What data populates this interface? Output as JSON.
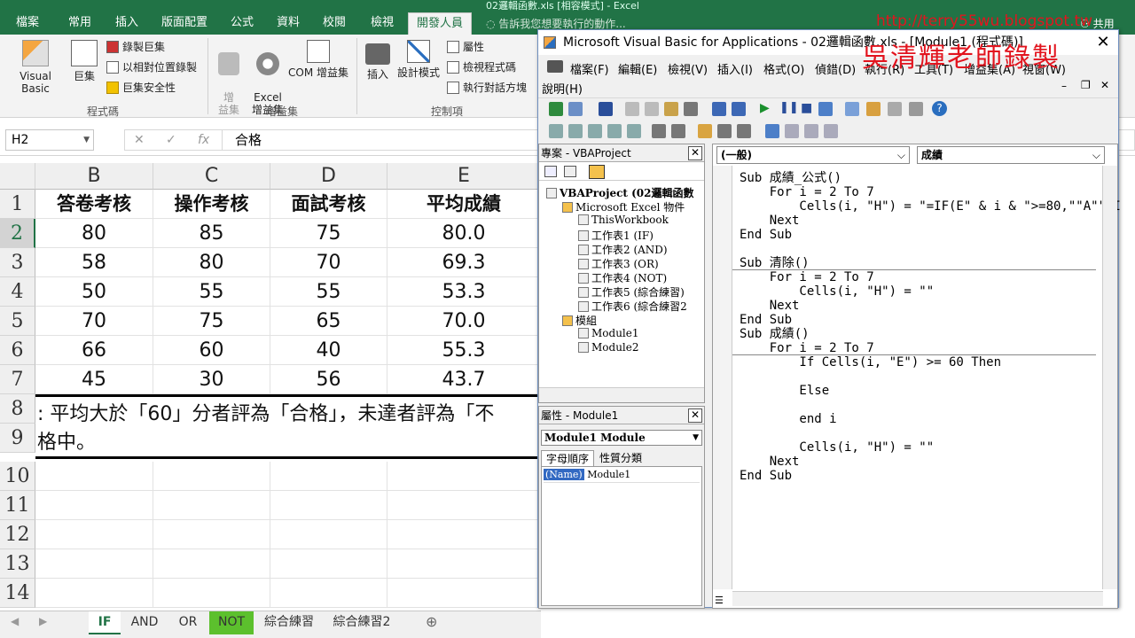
{
  "excel": {
    "title": "02邏輯函數.xls [相容模式] - Excel",
    "tellme": "告訴我您想要執行的動作...",
    "share": "共用",
    "tabs": [
      "檔案",
      "常用",
      "插入",
      "版面配置",
      "公式",
      "資料",
      "校閱",
      "檢視",
      "開發人員"
    ],
    "active_tab": "開發人員",
    "ribbon": {
      "code_group": "程式碼",
      "addins_group": "增益集",
      "controls_group": "控制項",
      "visual_basic": "Visual Basic",
      "macros": "巨集",
      "record_macro": "錄製巨集",
      "relative_ref": "以相對位置錄製",
      "macro_security": "巨集安全性",
      "addins": "增\n益集",
      "excel_addins": "Excel\n增益集",
      "com_addins": "COM 增益集",
      "insert": "插入",
      "design_mode": "設計模式",
      "properties": "屬性",
      "view_code": "檢視程式碼",
      "run_dialog": "執行對話方塊"
    },
    "namebox": "H2",
    "formula": "合格",
    "columns": [
      "B",
      "C",
      "D",
      "E"
    ],
    "rows": [
      "1",
      "2",
      "3",
      "4",
      "5",
      "6",
      "7",
      "8",
      "9",
      "10",
      "11",
      "12",
      "13",
      "14"
    ],
    "headers": [
      "答卷考核",
      "操作考核",
      "面試考核",
      "平均成績"
    ],
    "data": [
      [
        "80",
        "85",
        "75",
        "80.0"
      ],
      [
        "58",
        "80",
        "70",
        "69.3"
      ],
      [
        "50",
        "55",
        "55",
        "53.3"
      ],
      [
        "70",
        "75",
        "65",
        "70.0"
      ],
      [
        "66",
        "60",
        "40",
        "55.3"
      ],
      [
        "45",
        "30",
        "56",
        "43.7"
      ]
    ],
    "note_line1": ": 平均大於「60」分者評為「合格」，未達者評為「不",
    "note_line2": "格中。",
    "sheets": [
      "IF",
      "AND",
      "OR",
      "NOT",
      "綜合練習",
      "綜合練習2"
    ]
  },
  "vbe": {
    "title": "Microsoft Visual Basic for Applications - 02邏輯函數.xls - [Module1 (程式碼)]",
    "menu": [
      "檔案(F)",
      "編輯(E)",
      "檢視(V)",
      "插入(I)",
      "格式(O)",
      "偵錯(D)",
      "執行(R)",
      "工具(T)",
      "增益集(A)",
      "視窗(W)",
      "說明(H)"
    ],
    "project_title": "專案 - VBAProject",
    "tree": [
      {
        "label": "VBAProject (02邏輯函數",
        "level": 0
      },
      {
        "label": "Microsoft Excel 物件",
        "level": 1
      },
      {
        "label": "ThisWorkbook",
        "level": 2
      },
      {
        "label": "工作表1 (IF)",
        "level": 2
      },
      {
        "label": "工作表2 (AND)",
        "level": 2
      },
      {
        "label": "工作表3 (OR)",
        "level": 2
      },
      {
        "label": "工作表4 (NOT)",
        "level": 2
      },
      {
        "label": "工作表5 (綜合練習)",
        "level": 2
      },
      {
        "label": "工作表6 (綜合練習2",
        "level": 2
      },
      {
        "label": "模組",
        "level": 1
      },
      {
        "label": "Module1",
        "level": 2
      },
      {
        "label": "Module2",
        "level": 2
      }
    ],
    "props_title": "屬性 - Module1",
    "props_object": "Module1  Module",
    "props_tab1": "字母順序",
    "props_tab2": "性質分類",
    "props_name_key": "(Name)",
    "props_name_val": "Module1",
    "combo_left": "(一般)",
    "combo_right": "成績",
    "code": "Sub 成績_公式()\n    For i = 2 To 7\n        Cells(i, \"H\") = \"=IF(E\" & i & \">=80,\"\"A\"\",I\n    Next\nEnd Sub\n\nSub 清除()\n    For i = 2 To 7\n        Cells(i, \"H\") = \"\"\n    Next\nEnd Sub\nSub 成績()\n    For i = 2 To 7\n        If Cells(i, \"E\") >= 60 Then\n\n        Else\n\n        end i\n\n        Cells(i, \"H\") = \"\"\n    Next\nEnd Sub"
  },
  "watermark": {
    "url": "http://terry55wu.blogspot.tw",
    "text": "吳清輝老師錄製"
  }
}
